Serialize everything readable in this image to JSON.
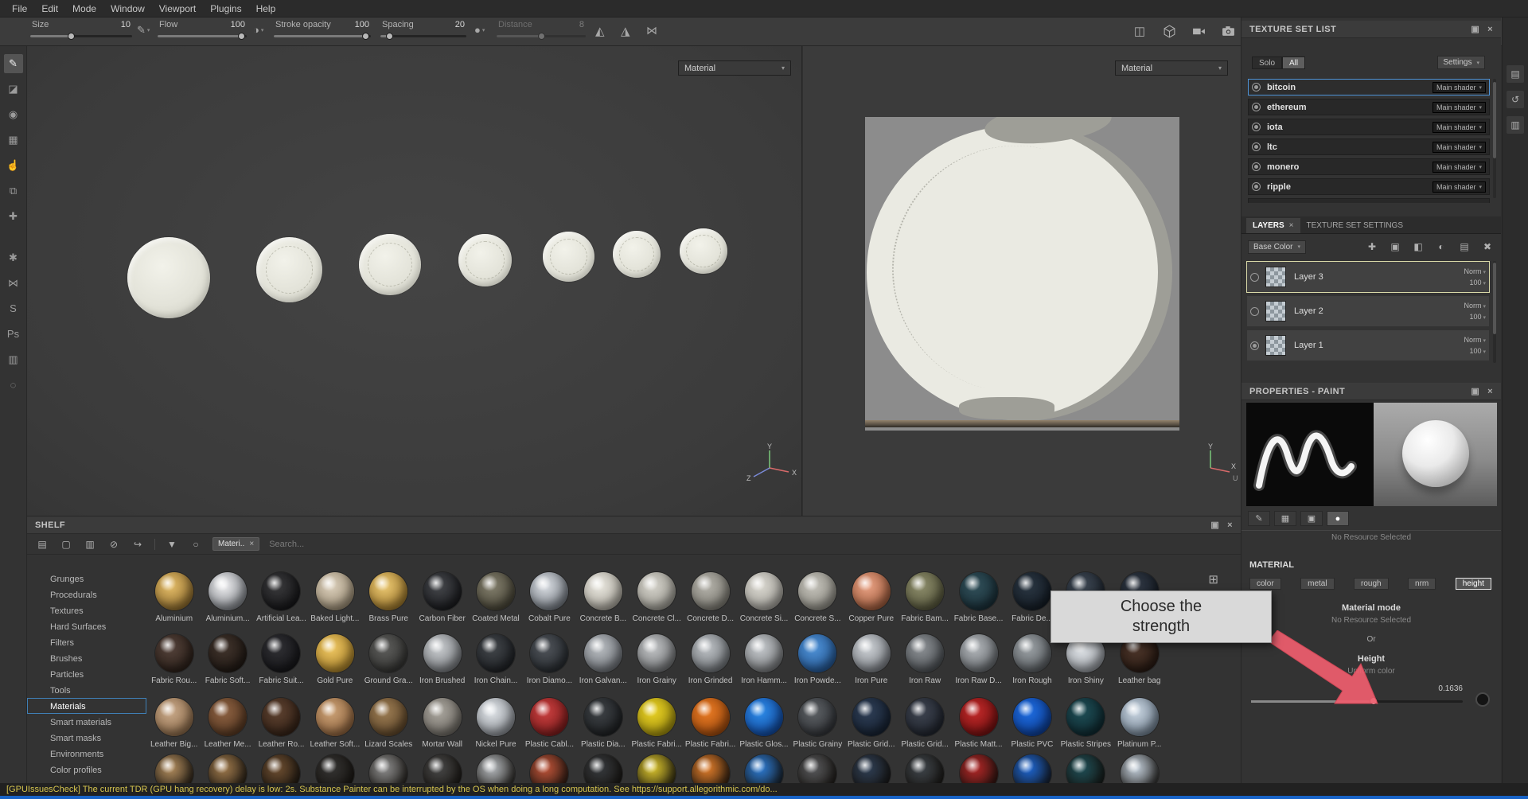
{
  "menubar": {
    "items": [
      "File",
      "Edit",
      "Mode",
      "Window",
      "Viewport",
      "Plugins",
      "Help"
    ]
  },
  "toolbar": {
    "size": {
      "label": "Size",
      "value": "10"
    },
    "flow": {
      "label": "Flow",
      "value": "100"
    },
    "stroke_opacity": {
      "label": "Stroke opacity",
      "value": "100"
    },
    "spacing": {
      "label": "Spacing",
      "value": "20"
    },
    "distance": {
      "label": "Distance",
      "value": "8"
    }
  },
  "tool_sidebar": {
    "tools": [
      {
        "name": "paint-tool",
        "glyph": "✎",
        "selected": true
      },
      {
        "name": "eraser-tool",
        "glyph": "◪"
      },
      {
        "name": "projection-tool",
        "glyph": "◉"
      },
      {
        "name": "polygon-fill-tool",
        "glyph": "▦"
      },
      {
        "name": "smudge-tool",
        "glyph": "☝"
      },
      {
        "name": "clone-tool",
        "glyph": "⧉"
      },
      {
        "name": "material-picker-tool",
        "glyph": "✚",
        "gap_after": true
      },
      {
        "name": "particles-tool",
        "glyph": "✱"
      },
      {
        "name": "symmetry-icon",
        "glyph": "⋈"
      },
      {
        "name": "substance-share-icon",
        "glyph": "S"
      },
      {
        "name": "photoshop-export-icon",
        "glyph": "Ps"
      },
      {
        "name": "script-icon",
        "glyph": "▥"
      },
      {
        "name": "render-icon",
        "glyph": "◌"
      }
    ]
  },
  "viewport_3d": {
    "mode_selector": "Material",
    "coin_count": 7,
    "axis": {
      "x": "X",
      "y": "Y",
      "z": "Z"
    }
  },
  "viewport_2d": {
    "mode_selector": "Material",
    "axis": {
      "x": "X",
      "y": "Y",
      "u": "U"
    }
  },
  "texture_set_list": {
    "title": "TEXTURE SET LIST",
    "solo_button": "Solo",
    "all_button": "All",
    "settings_button": "Settings",
    "sets": [
      {
        "name": "bitcoin",
        "shader": "Main shader",
        "selected": true
      },
      {
        "name": "ethereum",
        "shader": "Main shader"
      },
      {
        "name": "iota",
        "shader": "Main shader"
      },
      {
        "name": "ltc",
        "shader": "Main shader"
      },
      {
        "name": "monero",
        "shader": "Main shader"
      },
      {
        "name": "ripple",
        "shader": "Main shader"
      }
    ]
  },
  "layers_panel": {
    "tabs": {
      "layers": "LAYERS",
      "texture_set_settings": "TEXTURE SET SETTINGS"
    },
    "channel_selector": "Base Color",
    "toolbar_icons": [
      {
        "name": "add-effect-icon",
        "glyph": "✚"
      },
      {
        "name": "add-layer-icon",
        "glyph": "▣"
      },
      {
        "name": "add-fill-layer-icon",
        "glyph": "◧"
      },
      {
        "name": "add-mask-icon",
        "glyph": "◐"
      },
      {
        "name": "add-folder-icon",
        "glyph": "▤"
      },
      {
        "name": "delete-layer-icon",
        "glyph": "✖"
      }
    ],
    "layers": [
      {
        "name": "Layer 3",
        "blend": "Norm",
        "opacity": "100",
        "selected": true,
        "active_radio": false
      },
      {
        "name": "Layer 2",
        "blend": "Norm",
        "opacity": "100",
        "selected": false,
        "active_radio": false
      },
      {
        "name": "Layer 1",
        "blend": "Norm",
        "opacity": "100",
        "selected": false,
        "active_radio": true
      }
    ]
  },
  "properties_panel": {
    "title": "PROPERTIES - PAINT",
    "clipped_text": "No Resource Selected",
    "tool_tabs": [
      {
        "name": "brush-tab",
        "glyph": "✎"
      },
      {
        "name": "alpha-tab",
        "glyph": "▦"
      },
      {
        "name": "stencil-tab",
        "glyph": "▣"
      },
      {
        "name": "material-tab",
        "glyph": "●",
        "selected": true
      }
    ],
    "material_section": {
      "title": "MATERIAL",
      "channels": [
        "color",
        "metal",
        "rough",
        "nrm",
        "height"
      ],
      "selected_channel": "height",
      "material_mode_title": "Material mode",
      "material_mode_value": "No Resource Selected",
      "or_text": "Or",
      "height_title": "Height",
      "height_subtitle": "Uniform color",
      "height_value": "0.1636"
    }
  },
  "shelf": {
    "title": "SHELF",
    "filter_tag": "Materi..",
    "search_placeholder": "Search...",
    "toolbar_icons": [
      {
        "name": "folder-icon",
        "glyph": "▤"
      },
      {
        "name": "new-file-icon",
        "glyph": "▢"
      },
      {
        "name": "file-list-icon",
        "glyph": "▥"
      },
      {
        "name": "hide-resources-icon",
        "glyph": "⊘"
      },
      {
        "name": "import-resources-icon",
        "glyph": "↪"
      },
      {
        "name": "filter-funnel-icon",
        "glyph": "▼"
      },
      {
        "name": "filter-circle-icon",
        "glyph": "○"
      }
    ],
    "categories": [
      "Grunges",
      "Procedurals",
      "Textures",
      "Hard Surfaces",
      "Filters",
      "Brushes",
      "Particles",
      "Tools",
      "Materials",
      "Smart materials",
      "Smart masks",
      "Environments",
      "Color profiles"
    ],
    "selected_category": "Materials",
    "material_rows": [
      [
        {
          "name": "Aluminium",
          "c1": "#e8c06a",
          "c2": "#7a5a22"
        },
        {
          "name": "Aluminium...",
          "c1": "#f2f2f4",
          "c2": "#6a6e74"
        },
        {
          "name": "Artificial Lea...",
          "c1": "#3a3a3c",
          "c2": "#101012"
        },
        {
          "name": "Baked Light...",
          "c1": "#ded2be",
          "c2": "#8a7c64"
        },
        {
          "name": "Brass Pure",
          "c1": "#eecb74",
          "c2": "#8a651e"
        },
        {
          "name": "Carbon Fiber",
          "c1": "#46484c",
          "c2": "#121316"
        },
        {
          "name": "Coated Metal",
          "c1": "#84806e",
          "c2": "#3c392c"
        },
        {
          "name": "Cobalt Pure",
          "c1": "#dde1e6",
          "c2": "#5e646c"
        },
        {
          "name": "Concrete B...",
          "c1": "#eceae2",
          "c2": "#98948a"
        },
        {
          "name": "Concrete Cl...",
          "c1": "#d6d4cc",
          "c2": "#8c8a82"
        },
        {
          "name": "Concrete D...",
          "c1": "#b6b4ac",
          "c2": "#6e6c64"
        },
        {
          "name": "Concrete Si...",
          "c1": "#dcdad2",
          "c2": "#92908a"
        },
        {
          "name": "Concrete S...",
          "c1": "#c6c4bc",
          "c2": "#7e7c74"
        },
        {
          "name": "Copper Pure",
          "c1": "#eca486",
          "c2": "#8c4c2e"
        },
        {
          "name": "Fabric Bam...",
          "c1": "#8e8e6c",
          "c2": "#4a4a32"
        },
        {
          "name": "Fabric Base...",
          "c1": "#31505a",
          "c2": "#152830"
        },
        {
          "name": "Fabric De...",
          "c1": "#2a3642",
          "c2": "#111820"
        },
        {
          "name": "",
          "c1": "#3e4854",
          "c2": "#1a2028"
        },
        {
          "name": "",
          "c1": "#303844",
          "c2": "#141a22"
        }
      ],
      [
        {
          "name": "Fabric Rou...",
          "c1": "#54423a",
          "c2": "#241a14"
        },
        {
          "name": "Fabric Soft...",
          "c1": "#41342c",
          "c2": "#1a1410"
        },
        {
          "name": "Fabric Suit...",
          "c1": "#303034",
          "c2": "#111114"
        },
        {
          "name": "Gold Pure",
          "c1": "#f2ca64",
          "c2": "#96701e"
        },
        {
          "name": "Ground Gra...",
          "c1": "#5e5e5c",
          "c2": "#2c2c2a"
        },
        {
          "name": "Iron Brushed",
          "c1": "#cdd0d3",
          "c2": "#63666a"
        },
        {
          "name": "Iron Chain...",
          "c1": "#42464a",
          "c2": "#181a1e"
        },
        {
          "name": "Iron Diamo...",
          "c1": "#50545a",
          "c2": "#202428"
        },
        {
          "name": "Iron Galvan...",
          "c1": "#bcc0c4",
          "c2": "#5c6066"
        },
        {
          "name": "Iron Grainy",
          "c1": "#c4c6c8",
          "c2": "#606264"
        },
        {
          "name": "Iron Grinded",
          "c1": "#c0c4c8",
          "c2": "#5e6266"
        },
        {
          "name": "Iron Hamm...",
          "c1": "#c8ccd0",
          "c2": "#646668"
        },
        {
          "name": "Iron Powde...",
          "c1": "#5094da",
          "c2": "#1c4a82"
        },
        {
          "name": "Iron Pure",
          "c1": "#d0d4d8",
          "c2": "#686c72"
        },
        {
          "name": "Iron Raw",
          "c1": "#8e9296",
          "c2": "#404448"
        },
        {
          "name": "Iron Raw D...",
          "c1": "#b4b8bc",
          "c2": "#565a5e"
        },
        {
          "name": "Iron Rough",
          "c1": "#9ea4a8",
          "c2": "#4a4e52"
        },
        {
          "name": "Iron Shiny",
          "c1": "#ecf0f4",
          "c2": "#7a7e84"
        },
        {
          "name": "Leather bag",
          "c1": "#50382c",
          "c2": "#20140e"
        }
      ],
      [
        {
          "name": "Leather Big...",
          "c1": "#ccac8c",
          "c2": "#7c5c3c"
        },
        {
          "name": "Leather Me...",
          "c1": "#8e6242",
          "c2": "#4c301c"
        },
        {
          "name": "Leather Ro...",
          "c1": "#5e4230",
          "c2": "#2c1c12"
        },
        {
          "name": "Leather Soft...",
          "c1": "#cea478",
          "c2": "#805632"
        },
        {
          "name": "Lizard Scales",
          "c1": "#9e7e54",
          "c2": "#523c22"
        },
        {
          "name": "Mortar Wall",
          "c1": "#aca8a0",
          "c2": "#605c56"
        },
        {
          "name": "Nickel Pure",
          "c1": "#e4e8ec",
          "c2": "#74787e"
        },
        {
          "name": "Plastic Cabl...",
          "c1": "#cc4040",
          "c2": "#6e1616"
        },
        {
          "name": "Plastic Dia...",
          "c1": "#3e4246",
          "c2": "#181a1c"
        },
        {
          "name": "Plastic Fabri...",
          "c1": "#ecd424",
          "c2": "#8e7e0a"
        },
        {
          "name": "Plastic Fabri...",
          "c1": "#ec7c24",
          "c2": "#8e400a"
        },
        {
          "name": "Plastic Glos...",
          "c1": "#2e8eec",
          "c2": "#0c3c8e"
        },
        {
          "name": "Plastic Grainy",
          "c1": "#5e6266",
          "c2": "#282a2e"
        },
        {
          "name": "Plastic Grid...",
          "c1": "#2e3e56",
          "c2": "#121c2a"
        },
        {
          "name": "Plastic Grid...",
          "c1": "#3e4450",
          "c2": "#1a1e26"
        },
        {
          "name": "Plastic Matt...",
          "c1": "#c42a2a",
          "c2": "#640c0c"
        },
        {
          "name": "Plastic PVC",
          "c1": "#1e6ee4",
          "c2": "#0a3484"
        },
        {
          "name": "Plastic Stripes",
          "c1": "#1e4e56",
          "c2": "#0c2228"
        },
        {
          "name": "Platinum P...",
          "c1": "#ccd8e4",
          "c2": "#5e6e7e"
        }
      ]
    ],
    "partial_row_colors": [
      "#b48e5e",
      "#a07a4c",
      "#6e4e30",
      "#343332",
      "#8e8e8e",
      "#474747",
      "#b6babe",
      "#c25438",
      "#36393d",
      "#dcc62c",
      "#e47e2a",
      "#2c7cd6",
      "#58595c",
      "#2e3e54",
      "#3e444a",
      "#b42626",
      "#1c66d4",
      "#1e4e56",
      "#c4d0dc"
    ]
  },
  "right_strip": {
    "icons": [
      {
        "name": "display-settings-icon",
        "glyph": "▤"
      },
      {
        "name": "history-icon",
        "glyph": "↺"
      },
      {
        "name": "log-icon",
        "glyph": "▥"
      }
    ]
  },
  "overlay": {
    "tooltip_text": "Choose the strength",
    "arrow_color": "#ef5e6e"
  },
  "status_bar": {
    "text": "[GPUIssuesCheck] The current TDR (GPU hang recovery) delay is low: 2s. Substance Painter can be interrupted by the OS when doing a long computation. See https://support.allegorithmic.com/do..."
  }
}
